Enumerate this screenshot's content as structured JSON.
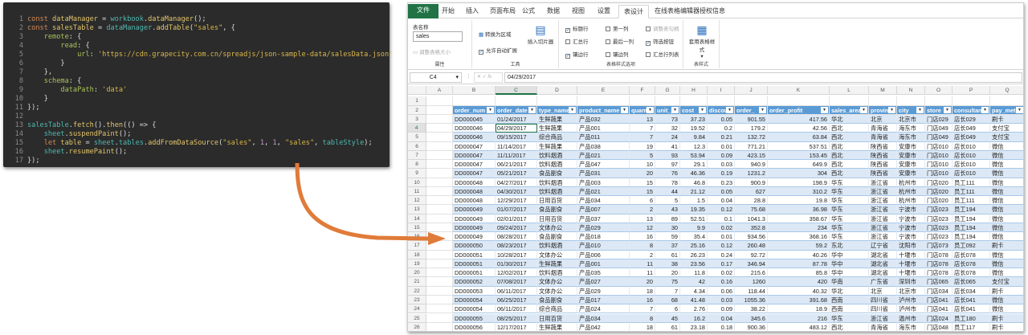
{
  "code": {
    "lines": [
      [
        [
          "k",
          "const "
        ],
        [
          "v",
          "dataManager"
        ],
        [
          "o",
          " = "
        ],
        [
          "f",
          "workbook"
        ],
        [
          "o",
          "."
        ],
        [
          "v",
          "dataManager"
        ],
        [
          "o",
          "();"
        ]
      ],
      [
        [
          "k",
          "const "
        ],
        [
          "v",
          "salesTable"
        ],
        [
          "o",
          " = "
        ],
        [
          "f",
          "dataManager"
        ],
        [
          "o",
          "."
        ],
        [
          "v",
          "addTable"
        ],
        [
          "o",
          "("
        ],
        [
          "s",
          "\"sales\""
        ],
        [
          "o",
          ", {"
        ]
      ],
      [
        [
          "o",
          "    "
        ],
        [
          "p",
          "remote"
        ],
        [
          "o",
          ": {"
        ]
      ],
      [
        [
          "o",
          "        "
        ],
        [
          "p",
          "read"
        ],
        [
          "o",
          ": {"
        ]
      ],
      [
        [
          "o",
          "            "
        ],
        [
          "p",
          "url"
        ],
        [
          "o",
          ": "
        ],
        [
          "s",
          "'https://cdn.grapecity.com.cn/spreadjs/json-sample-data/salesData.json'"
        ]
      ],
      [
        [
          "o",
          "        }"
        ]
      ],
      [
        [
          "o",
          "    },"
        ]
      ],
      [
        [
          "o",
          "    "
        ],
        [
          "p",
          "schema"
        ],
        [
          "o",
          ": {"
        ]
      ],
      [
        [
          "o",
          "        "
        ],
        [
          "p",
          "dataPath"
        ],
        [
          "o",
          ": "
        ],
        [
          "s",
          "'data'"
        ]
      ],
      [
        [
          "o",
          "    }"
        ]
      ],
      [
        [
          "o",
          "});"
        ]
      ],
      [],
      [
        [
          "f",
          "salesTable"
        ],
        [
          "o",
          "."
        ],
        [
          "v",
          "fetch"
        ],
        [
          "o",
          "()."
        ],
        [
          "v",
          "then"
        ],
        [
          "o",
          "(() => {"
        ]
      ],
      [
        [
          "o",
          "    "
        ],
        [
          "f",
          "sheet"
        ],
        [
          "o",
          "."
        ],
        [
          "v",
          "suspendPaint"
        ],
        [
          "o",
          "();"
        ]
      ],
      [
        [
          "o",
          "    "
        ],
        [
          "k",
          "let "
        ],
        [
          "v",
          "table"
        ],
        [
          "o",
          " = "
        ],
        [
          "f",
          "sheet"
        ],
        [
          "o",
          "."
        ],
        [
          "f",
          "tables"
        ],
        [
          "o",
          "."
        ],
        [
          "v",
          "addFromDataSource"
        ],
        [
          "o",
          "("
        ],
        [
          "s",
          "\"sales\""
        ],
        [
          "o",
          ", "
        ],
        [
          "n",
          "1"
        ],
        [
          "o",
          ", "
        ],
        [
          "n",
          "1"
        ],
        [
          "o",
          ", "
        ],
        [
          "s",
          "\"sales\""
        ],
        [
          "o",
          ", "
        ],
        [
          "f",
          "tableStyle"
        ],
        [
          "o",
          ");"
        ]
      ],
      [
        [
          "o",
          "    "
        ],
        [
          "f",
          "sheet"
        ],
        [
          "o",
          "."
        ],
        [
          "v",
          "resumePaint"
        ],
        [
          "o",
          "();"
        ]
      ],
      [
        [
          "o",
          "});"
        ]
      ]
    ]
  },
  "ribbon": {
    "tabs": [
      "文件",
      "开始",
      "插入",
      "页面布局",
      "公式",
      "数据",
      "视图",
      "设置",
      "表设计",
      "在线表格编辑器授权信息"
    ],
    "table_name_label": "表名称",
    "table_name_value": "sales",
    "resize_table": "调整表格大小",
    "group_properties": "属性",
    "convert_to_range": "转换为区域",
    "allow_auto_expand": "允许自动扩展",
    "insert_slicer": "插入切片器",
    "group_tools": "工具",
    "options": [
      {
        "label": "标题行",
        "checked": true
      },
      {
        "label": "汇总行",
        "checked": false
      },
      {
        "label": "镶边行",
        "checked": true
      },
      {
        "label": "第一列",
        "checked": false
      },
      {
        "label": "最后一列",
        "checked": false
      },
      {
        "label": "镶边列",
        "checked": false
      },
      {
        "label": "调整表句柄",
        "checked": false,
        "disabled": true
      },
      {
        "label": "筛选按钮",
        "checked": true
      },
      {
        "label": "汇总行列表",
        "checked": false
      }
    ],
    "group_style_options": "表格样式选项",
    "table_styles": "套用表格样式",
    "group_styles": "表样式"
  },
  "formula": {
    "cell": "C4",
    "fx": "fx",
    "value": "04/29/2017"
  },
  "columns": [
    "A",
    "B",
    "C",
    "D",
    "E",
    "F",
    "G",
    "H",
    "I",
    "J",
    "K",
    "L",
    "M",
    "N",
    "O",
    "P",
    "Q"
  ],
  "headers": [
    "order_num",
    "order_date",
    "type_name",
    "product_name",
    "quantit",
    "unit_p",
    "cost",
    "discou",
    "order_",
    "order_profit",
    "sales_area",
    "provin",
    "city",
    "store",
    "consultant",
    "pay_metho"
  ],
  "rows": [
    [
      "DD000045",
      "01/24/2017",
      "生鲜蔬果",
      "产品032",
      "13",
      "73",
      "37.23",
      "0.05",
      "901.55",
      "417.56",
      "华北",
      "北京",
      "北京市",
      "门店029",
      "店长029",
      "刷卡"
    ],
    [
      "DD000046",
      "04/29/2017",
      "生鲜蔬果",
      "产品001",
      "7",
      "32",
      "19.52",
      "0.2",
      "179.2",
      "42.56",
      "西北",
      "青海省",
      "海东市",
      "门店049",
      "店长049",
      "支付宝"
    ],
    [
      "DD000046",
      "09/15/2017",
      "综合商品",
      "产品011",
      "7",
      "24",
      "9.84",
      "0.21",
      "132.72",
      "63.84",
      "西北",
      "青海省",
      "海东市",
      "门店049",
      "店长049",
      "支付宝"
    ],
    [
      "DD000047",
      "11/14/2017",
      "生鲜蔬果",
      "产品038",
      "19",
      "41",
      "12.3",
      "0.01",
      "771.21",
      "537.51",
      "西北",
      "陕西省",
      "安康市",
      "门店010",
      "店长010",
      "微信"
    ],
    [
      "DD000047",
      "11/11/2017",
      "饮料烟酒",
      "产品021",
      "5",
      "93",
      "53.94",
      "0.09",
      "423.15",
      "153.45",
      "西北",
      "陕西省",
      "安康市",
      "门店010",
      "店长010",
      "微信"
    ],
    [
      "DD000047",
      "06/21/2017",
      "饮料烟酒",
      "产品047",
      "10",
      "97",
      "29.1",
      "0.03",
      "940.9",
      "649.9",
      "西北",
      "陕西省",
      "安康市",
      "门店010",
      "店长010",
      "微信"
    ],
    [
      "DD000047",
      "05/21/2017",
      "食品副食",
      "产品031",
      "20",
      "76",
      "46.36",
      "0.19",
      "1231.2",
      "304",
      "西北",
      "陕西省",
      "安康市",
      "门店010",
      "店长010",
      "微信"
    ],
    [
      "DD000048",
      "04/27/2017",
      "饮料烟酒",
      "产品003",
      "15",
      "78",
      "46.8",
      "0.23",
      "900.9",
      "198.9",
      "华东",
      "浙江省",
      "杭州市",
      "门店020",
      "员工111",
      "微信"
    ],
    [
      "DD000048",
      "04/30/2017",
      "饮料烟酒",
      "产品021",
      "15",
      "44",
      "21.12",
      "0.05",
      "627",
      "310.2",
      "华东",
      "浙江省",
      "杭州市",
      "门店020",
      "员工111",
      "微信"
    ],
    [
      "DD000048",
      "12/29/2017",
      "日用百货",
      "产品034",
      "6",
      "5",
      "1.5",
      "0.04",
      "28.8",
      "19.8",
      "华东",
      "浙江省",
      "杭州市",
      "门店020",
      "员工111",
      "微信"
    ],
    [
      "DD000049",
      "01/07/2017",
      "食品副食",
      "产品007",
      "2",
      "43",
      "19.35",
      "0.12",
      "75.68",
      "36.98",
      "华东",
      "浙江省",
      "宁波市",
      "门店023",
      "员工194",
      "微信"
    ],
    [
      "DD000049",
      "02/01/2017",
      "日用百货",
      "产品037",
      "13",
      "89",
      "52.51",
      "0.1",
      "1041.3",
      "358.67",
      "华东",
      "浙江省",
      "宁波市",
      "门店023",
      "员工194",
      "微信"
    ],
    [
      "DD000049",
      "09/24/2017",
      "文体办公",
      "产品029",
      "12",
      "30",
      "9.9",
      "0.02",
      "352.8",
      "234",
      "华东",
      "浙江省",
      "宁波市",
      "门店023",
      "员工194",
      "微信"
    ],
    [
      "DD000049",
      "08/28/2017",
      "食品副食",
      "产品018",
      "16",
      "59",
      "35.4",
      "0.01",
      "934.56",
      "368.16",
      "华东",
      "浙江省",
      "宁波市",
      "门店023",
      "员工194",
      "微信"
    ],
    [
      "DD000050",
      "08/23/2017",
      "饮料烟酒",
      "产品010",
      "8",
      "37",
      "25.16",
      "0.12",
      "260.48",
      "59.2",
      "东北",
      "辽宁省",
      "沈阳市",
      "门店073",
      "员工092",
      "刷卡"
    ],
    [
      "DD000051",
      "10/28/2017",
      "文体办公",
      "产品006",
      "2",
      "61",
      "26.23",
      "0.24",
      "92.72",
      "40.26",
      "华中",
      "湖北省",
      "十堰市",
      "门店078",
      "店长078",
      "微信"
    ],
    [
      "DD000051",
      "01/30/2017",
      "生鲜蔬果",
      "产品001",
      "11",
      "38",
      "23.56",
      "0.17",
      "346.94",
      "87.78",
      "华中",
      "湖北省",
      "十堰市",
      "门店078",
      "店长078",
      "微信"
    ],
    [
      "DD000051",
      "12/02/2017",
      "饮料烟酒",
      "产品035",
      "11",
      "20",
      "11.8",
      "0.02",
      "215.6",
      "85.8",
      "华中",
      "湖北省",
      "十堰市",
      "门店078",
      "店长078",
      "微信"
    ],
    [
      "DD000052",
      "07/08/2017",
      "文体办公",
      "产品027",
      "20",
      "75",
      "42",
      "0.16",
      "1260",
      "420",
      "华南",
      "广东省",
      "深圳市",
      "门店065",
      "店长065",
      "支付宝"
    ],
    [
      "DD000053",
      "06/11/2017",
      "文体办公",
      "产品029",
      "18",
      "7",
      "4.34",
      "0.06",
      "118.44",
      "40.32",
      "华北",
      "北京",
      "北京市",
      "门店034",
      "店长034",
      "刷卡"
    ],
    [
      "DD000054",
      "06/25/2017",
      "食品副食",
      "产品017",
      "16",
      "68",
      "41.48",
      "0.03",
      "1055.36",
      "391.68",
      "西南",
      "四川省",
      "泸州市",
      "门店041",
      "店长041",
      "微信"
    ],
    [
      "DD000054",
      "06/11/2017",
      "综合商品",
      "产品024",
      "7",
      "6",
      "2.76",
      "0.09",
      "38.22",
      "18.9",
      "西南",
      "四川省",
      "泸州市",
      "门店041",
      "店长041",
      "微信"
    ],
    [
      "DD000055",
      "08/25/2017",
      "日用百货",
      "产品034",
      "8",
      "45",
      "16.2",
      "0.04",
      "345.6",
      "216",
      "华东",
      "浙江省",
      "温州市",
      "门店024",
      "员工180",
      "刷卡"
    ],
    [
      "DD000056",
      "12/17/2017",
      "生鲜蔬果",
      "产品042",
      "18",
      "61",
      "23.18",
      "0.18",
      "900.36",
      "483.12",
      "西北",
      "青海省",
      "海东市",
      "门店048",
      "员工117",
      "刷卡"
    ]
  ],
  "colors": {
    "accent": "#217346",
    "header": "#5b9bd5",
    "band": "#dce8f5",
    "arrow": "#e07b39"
  }
}
